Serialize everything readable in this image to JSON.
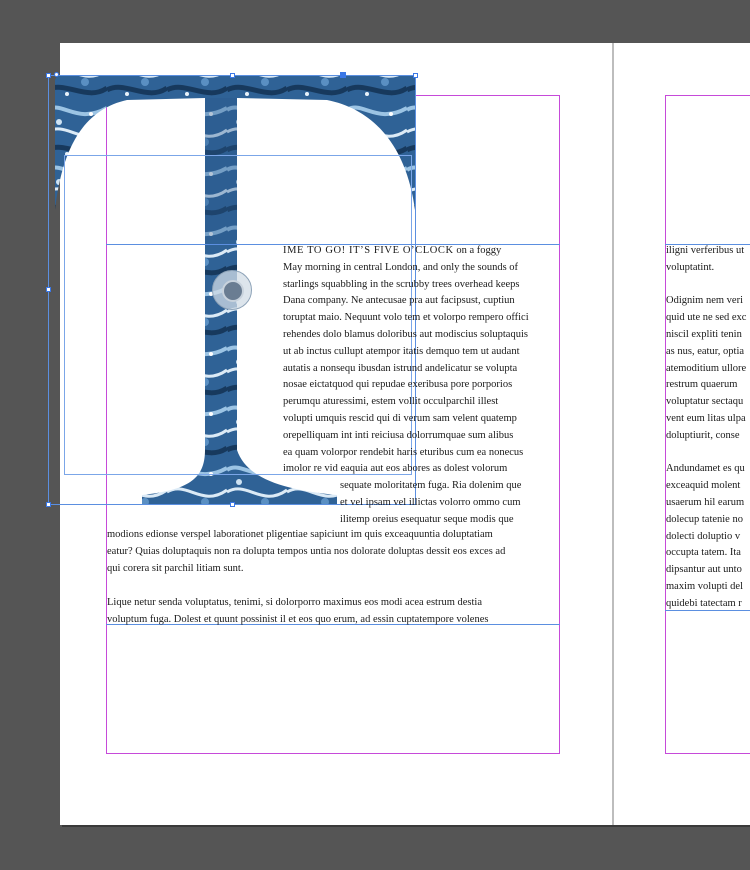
{
  "colors": {
    "pasteboard": "#555555",
    "page": "#ffffff",
    "margin_guide": "#c64ad9",
    "frame": "#5b8fe0",
    "dropcap_base": "#2f6296"
  },
  "icons": {
    "dropcap": "letter-t-marbled-image",
    "content_grabber": "content-grabber-icon"
  },
  "dropcap_letter": "T",
  "story_left": {
    "lead_caps": "IME TO GO! IT’S FIVE O’CLOCK",
    "lead_rest": " on a foggy",
    "lines": [
      "May morning in central London, and only the sounds of",
      "starlings squabbling in the scrubby trees overhead keeps",
      "Dana company. Ne antecusae pra aut facipsust, cuptiun",
      "toruptat maio. Nequunt volo tem et volorpo rempero offici",
      "rehendes dolo blamus doloribus aut modiscius soluptaquis",
      "ut ab inctus cullupt atempor itatis demquo tem ut audant",
      "autatis a nonsequ ibusdan istrund andelicatur se volupta",
      "nosae eictatquod qui repudae exeribusa pore porporios",
      "perumqu aturessimi, estem vollit occulparchil illest",
      "volupti umquis rescid qui di verum sam velent quatemp",
      "orepelliquam int inti reiciusa dolorrumquae sum alibus",
      "ea quam volorpor rendebit haris eturibus cum ea nonecus",
      " imolor re vid eaquia aut eos abores as dolest volorum"
    ],
    "indent_lines": [
      "sequate moloritatem fuga. Ria dolenim que",
      "et vel ipsam vel illictas volorro ommo cum",
      "ilitemp oreius esequatur seque modis que"
    ],
    "full_lines": [
      "modions edionse verspel laborationet pligentiae sapiciunt im quis exceaquuntia doluptatiam",
      "eatur? Quias doluptaquis non ra dolupta tempos untia nos dolorate doluptas dessit eos exces ad",
      "qui corera sit parchil litiam sunt."
    ],
    "para2": [
      "Lique netur senda voluptatus, tenimi, si dolorporro maximus eos modi acea estrum destia",
      "voluptum fuga. Dolest et quunt possinist il et eos quo erum, ad essin cuptatempore volenes"
    ]
  },
  "story_right": {
    "lines": [
      "iligni verferibus ut",
      "voluptatint.",
      "",
      "Odignim nem veri",
      "quid ute ne sed exc",
      "niscil expliti tenin",
      "as nus, eatur, optia",
      "atemoditium ullore",
      "restrum quaerum",
      "voluptatur sectaqu",
      "vent eum litas ulpa",
      "doluptiurit, conse",
      "",
      "Andundamet es qu",
      "exceaquid molent",
      "usaerum hil earum",
      "dolecup tatenie no",
      "dolecti doluptio v",
      "occupta tatem. Ita",
      "dipsantur aut unto",
      "maxim volupti del",
      "quidebi tatectam r"
    ]
  }
}
